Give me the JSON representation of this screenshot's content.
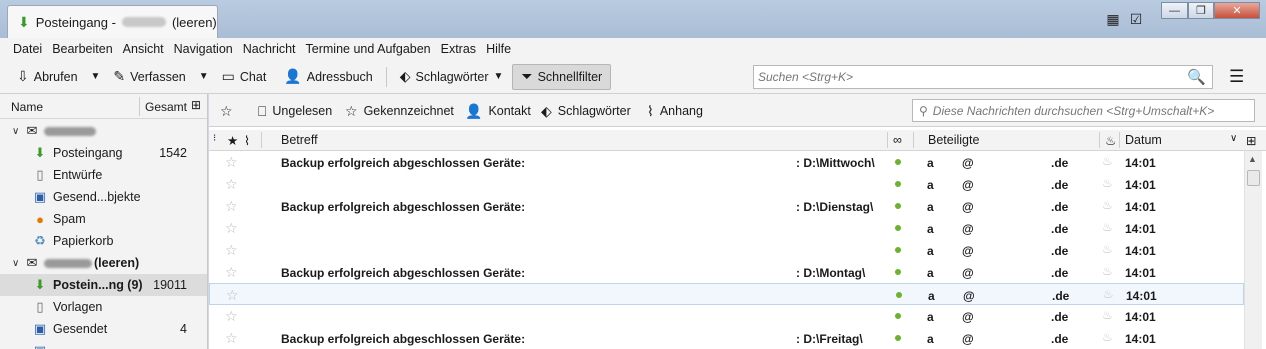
{
  "window": {
    "tab_title": "Posteingang -",
    "tab_suffix": "(leeren)",
    "min_label": "—",
    "max_label": "❐",
    "close_label": "✕"
  },
  "menu": [
    "Datei",
    "Bearbeiten",
    "Ansicht",
    "Navigation",
    "Nachricht",
    "Termine und Aufgaben",
    "Extras",
    "Hilfe"
  ],
  "toolbar": {
    "get_label": "Abrufen",
    "write_label": "Verfassen",
    "chat_label": "Chat",
    "addressbook_label": "Adressbuch",
    "tags_label": "Schlagwörter",
    "quickfilter_label": "Schnellfilter",
    "search_placeholder": "Suchen <Strg+K>"
  },
  "folderpane": {
    "col_name": "Name",
    "col_total": "Gesamt",
    "account1": {
      "suffix": ""
    },
    "account1_folders": [
      {
        "label": "Posteingang",
        "count": "1542",
        "icon": "inbox-icon"
      },
      {
        "label": "Entwürfe",
        "count": "",
        "icon": "drafts-icon"
      },
      {
        "label": "Gesend...bjekte",
        "count": "",
        "icon": "sent-icon"
      },
      {
        "label": "Spam",
        "count": "",
        "icon": "spam-icon"
      },
      {
        "label": "Papierkorb",
        "count": "",
        "icon": "trash-icon"
      }
    ],
    "account2": {
      "suffix": "(leeren)"
    },
    "account2_folders": [
      {
        "label": "Postein...ng (9)",
        "count": "19011",
        "icon": "inbox-icon"
      },
      {
        "label": "Vorlagen",
        "count": "",
        "icon": "templates-icon"
      },
      {
        "label": "Gesendet",
        "count": "4",
        "icon": "sent-icon"
      }
    ]
  },
  "quickfilter": {
    "unread_label": "Ungelesen",
    "starred_label": "Gekennzeichnet",
    "contact_label": "Kontakt",
    "tags_label": "Schlagwörter",
    "attachment_label": "Anhang",
    "search_placeholder": "Diese Nachrichten durchsuchen <Strg+Umschalt+K>"
  },
  "threadpane": {
    "col_subject": "Betreff",
    "col_correspondents": "Beteiligte",
    "col_date": "Datum",
    "rows": [
      {
        "subject": "Backup erfolgreich abgeschlossen Geräte:",
        "path": ": D:\\Mittwoch\\",
        "from_a": "a",
        "from_at": "@",
        "from_domain": ".de",
        "date": "14:01"
      },
      {
        "subject": "",
        "path": "",
        "from_a": "a",
        "from_at": "@",
        "from_domain": ".de",
        "date": "14:01"
      },
      {
        "subject": "Backup erfolgreich abgeschlossen Geräte:",
        "path": ": D:\\Dienstag\\",
        "from_a": "a",
        "from_at": "@",
        "from_domain": ".de",
        "date": "14:01"
      },
      {
        "subject": "",
        "path": "",
        "from_a": "a",
        "from_at": "@",
        "from_domain": ".de",
        "date": "14:01"
      },
      {
        "subject": "",
        "path": "",
        "from_a": "a",
        "from_at": "@",
        "from_domain": ".de",
        "date": "14:01"
      },
      {
        "subject": "Backup erfolgreich abgeschlossen Geräte:",
        "path": ": D:\\Montag\\",
        "from_a": "a",
        "from_at": "@",
        "from_domain": ".de",
        "date": "14:01"
      },
      {
        "subject": "",
        "path": "",
        "from_a": "a",
        "from_at": "@",
        "from_domain": ".de",
        "date": "14:01"
      },
      {
        "subject": "",
        "path": "",
        "from_a": "a",
        "from_at": "@",
        "from_domain": ".de",
        "date": "14:01"
      },
      {
        "subject": "Backup erfolgreich abgeschlossen Geräte:",
        "path": ": D:\\Freitag\\",
        "from_a": "a",
        "from_at": "@",
        "from_domain": ".de",
        "date": "14:01"
      }
    ]
  },
  "colors": {
    "read_dot": "#6ab42d",
    "highlight_row": "#f2f7fd"
  }
}
